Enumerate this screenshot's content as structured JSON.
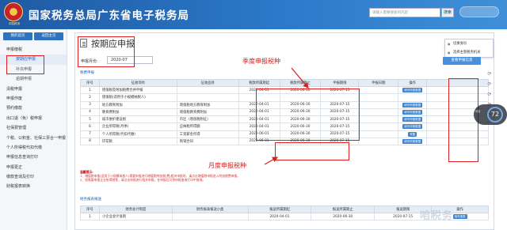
{
  "header": {
    "logo_sub": "中国税务",
    "title": "国家税务总局广东省电子税务局",
    "search_placeholder": "请输入需要搜索的内容",
    "search_button": "搜索"
  },
  "sidebar": {
    "home_label": "我的首页",
    "back_label": "返回主页",
    "items": [
      {
        "label": "申报缴税",
        "sub": false
      },
      {
        "label": "按期应申报",
        "sub": true,
        "active": true
      },
      {
        "label": "补充申报",
        "sub": true
      },
      {
        "label": "逾期申报",
        "sub": true
      },
      {
        "label": "清税申报",
        "sub": false
      },
      {
        "label": "申报作废",
        "sub": false
      },
      {
        "label": "预约缴款",
        "sub": false
      },
      {
        "label": "出口退（免）税申报",
        "sub": false
      },
      {
        "label": "社保费管理",
        "sub": false
      },
      {
        "label": "个税、公积金、社保三票合一申报",
        "sub": false
      },
      {
        "label": "个人所得税代扣代缴",
        "sub": false
      },
      {
        "label": "申报信息查询打印",
        "sub": false
      },
      {
        "label": "申报更正",
        "sub": false
      },
      {
        "label": "缴款查询及打印",
        "sub": false
      },
      {
        "label": "财税报表转换",
        "sub": false
      }
    ]
  },
  "main": {
    "title": "按期应申报",
    "menu": [
      "切换身份",
      "选择主管税务机关"
    ],
    "period_label": "申报月份:",
    "period_value": "2020-07",
    "query_button": "查看申报信息",
    "tax_section": "税费申报",
    "tax_headers": [
      "序号",
      "征收项目",
      "征收品目",
      "税款所属期起",
      "税款所属期止",
      "申报期限",
      "申报日期",
      "操作"
    ],
    "tax_rows": [
      {
        "no": "1",
        "item": "增值税及附加税费合并申报",
        "sub": "",
        "start": "2020-04-01",
        "end": "2020-06-30",
        "deadline": "2020-07-15",
        "date": "",
        "op": "填写申报数据"
      },
      {
        "no": "2",
        "item": "增值税(适用于小规模纳税人)",
        "sub": "",
        "start": "",
        "end": "",
        "deadline": "",
        "date": "",
        "op": ""
      },
      {
        "no": "3",
        "item": "地方教育附加",
        "sub": "增值税地方教育附加",
        "start": "2020-04-01",
        "end": "2020-06-30",
        "deadline": "2020-07-15",
        "date": "",
        "op": "填写申报数据"
      },
      {
        "no": "4",
        "item": "教育费附加",
        "sub": "增值税教育费附加",
        "start": "2020-04-01",
        "end": "2020-06-30",
        "deadline": "2020-07-15",
        "date": "",
        "op": "填写申报数据"
      },
      {
        "no": "5",
        "item": "城市维护建设税",
        "sub": "市区（增值税附征）",
        "start": "2020-04-01",
        "end": "2020-06-30",
        "deadline": "2020-07-15",
        "date": "",
        "op": "填写申报数据"
      },
      {
        "no": "6",
        "item": "企业所得税(月季)",
        "sub": "应纳税所得额",
        "start": "2020-04-01",
        "end": "2020-06-30",
        "deadline": "2020-07-15",
        "date": "",
        "op": "填写申报数据"
      },
      {
        "no": "7",
        "item": "个人所得税(代扣代缴)",
        "sub": "工资薪金所得",
        "start": "2020-06-01",
        "end": "2020-06-30",
        "deadline": "2020-07-15",
        "date": "",
        "op": "采集"
      },
      {
        "no": "8",
        "item": "印花税",
        "sub": "购销合同",
        "start": "2020-06-01",
        "end": "2020-06-30",
        "deadline": "2020-07-15",
        "date": "",
        "op": "填写申报数据"
      }
    ],
    "note_heading": "温馨提示:",
    "note_lines": [
      "1、增值税申报(适用于小规模纳税人)需要申报进行增值税附加税(费)相关申报时，请点击增值税申报进入附加税费申报。",
      "2、如需要申报企业所得税等，请点击申报进行相关申报，在申报后可到申报查询打印中查询。"
    ],
    "fin_section": "财务报表报送",
    "fin_headers": [
      "序号",
      "财务会计制度",
      "财务报表报送小类",
      "报送所属期起",
      "报送所属期止",
      "报送期限",
      "操作"
    ],
    "fin_rows": [
      {
        "no": "1",
        "system": "小企业会计准则",
        "type": "",
        "start": "2020-04-01",
        "end": "2020-06-30",
        "deadline": "2020-07-15",
        "op": "填写报表"
      }
    ]
  },
  "annotations": {
    "quarterly": "季度申报税种",
    "monthly": "月度申报税种"
  },
  "widget": {
    "value": "72",
    "label": "网速"
  },
  "watermark": "咱税务"
}
